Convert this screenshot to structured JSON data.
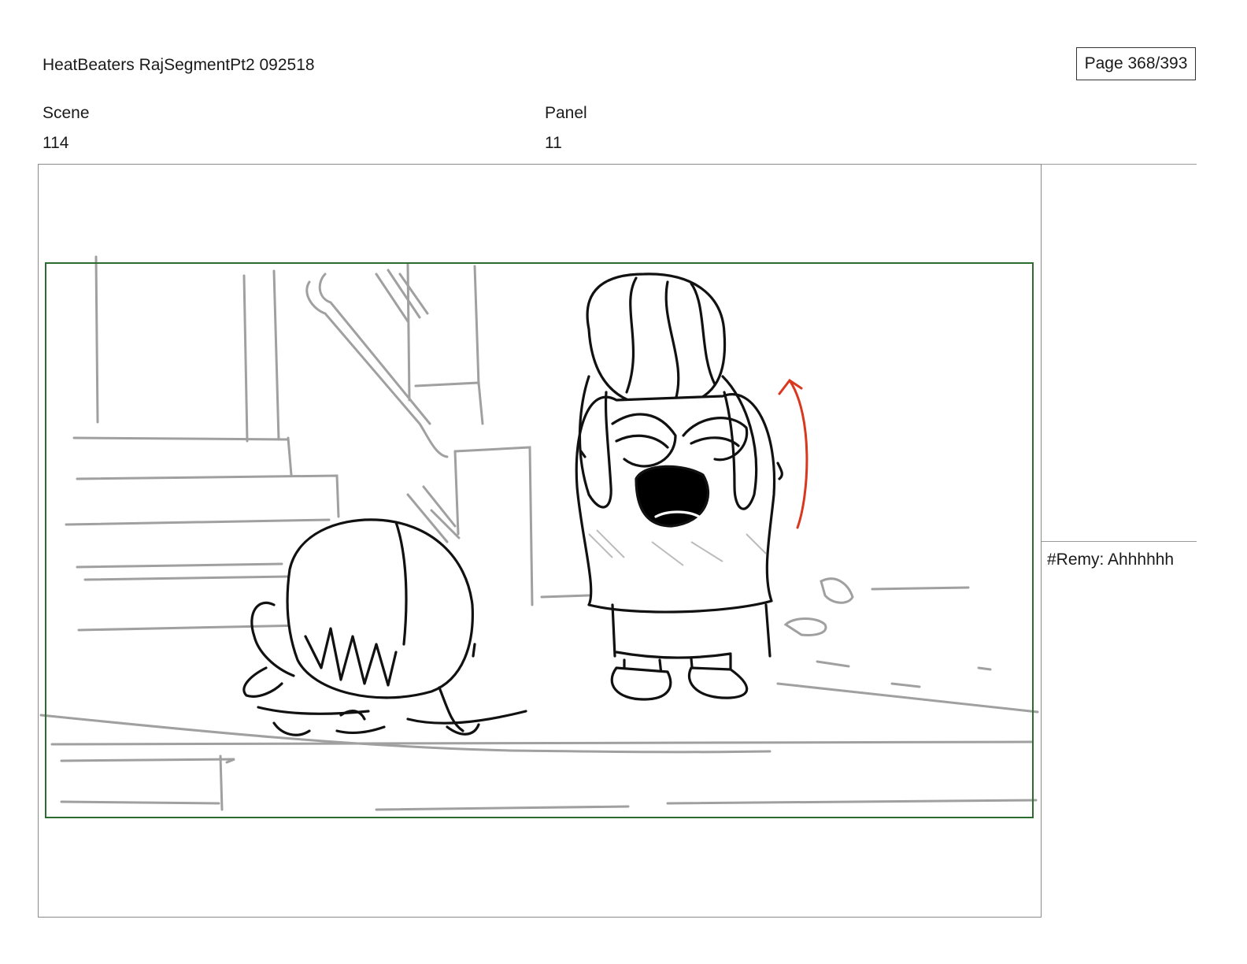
{
  "header": {
    "title": "HeatBeaters RajSegmentPt2 092518",
    "page": "Page 368/393"
  },
  "scene": {
    "label": "Scene",
    "value": "114"
  },
  "panel": {
    "label": "Panel",
    "value": "11"
  },
  "notes": {
    "dialogue": "#Remy: Ahhhhhh"
  },
  "colors": {
    "safe_frame": "#2e6b2e",
    "pencil": "#9a9a9a",
    "ink": "#111111",
    "motion_arrow": "#d9381e"
  },
  "icons": [
    "action-arrow-icon"
  ]
}
